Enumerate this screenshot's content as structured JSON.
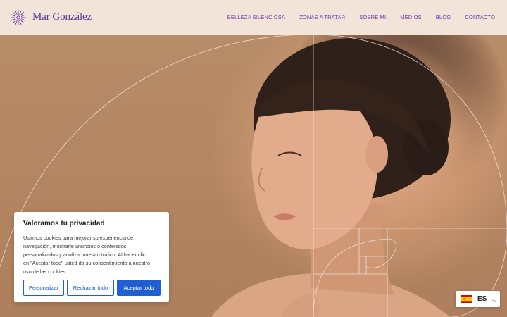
{
  "brand": {
    "name": "Mar González"
  },
  "nav": {
    "items": [
      {
        "label": "BELLEZA SILENCIOSA"
      },
      {
        "label": "ZONAS A TRATAR"
      },
      {
        "label": "SOBRE MI"
      },
      {
        "label": "MEDIOS"
      },
      {
        "label": "BLOG"
      },
      {
        "label": "CONTACTO"
      }
    ]
  },
  "cookie": {
    "title": "Valoramos tu privacidad",
    "lines": [
      "Usamos cookies para mejorar su experiencia de",
      "navegación, mostrarle anuncios o contenidos",
      "personalizados y analizar nuestro tráfico. Al hacer clic",
      "en \"Aceptar todo\" usted da su consentimiento a nuestro",
      "uso de las cookies."
    ],
    "buttons": {
      "customize": "Personalizar",
      "reject": "Rechazar todo",
      "accept": "Aceptar todo"
    }
  },
  "language": {
    "code": "ES",
    "flag": "spain-flag-icon"
  },
  "colors": {
    "header_bg": "#f3e4da",
    "brand_purple": "#5b3a8a",
    "nav_purple": "#6a3aa6",
    "button_blue": "#1f5fd1",
    "hero_bg": "#b98c67"
  }
}
